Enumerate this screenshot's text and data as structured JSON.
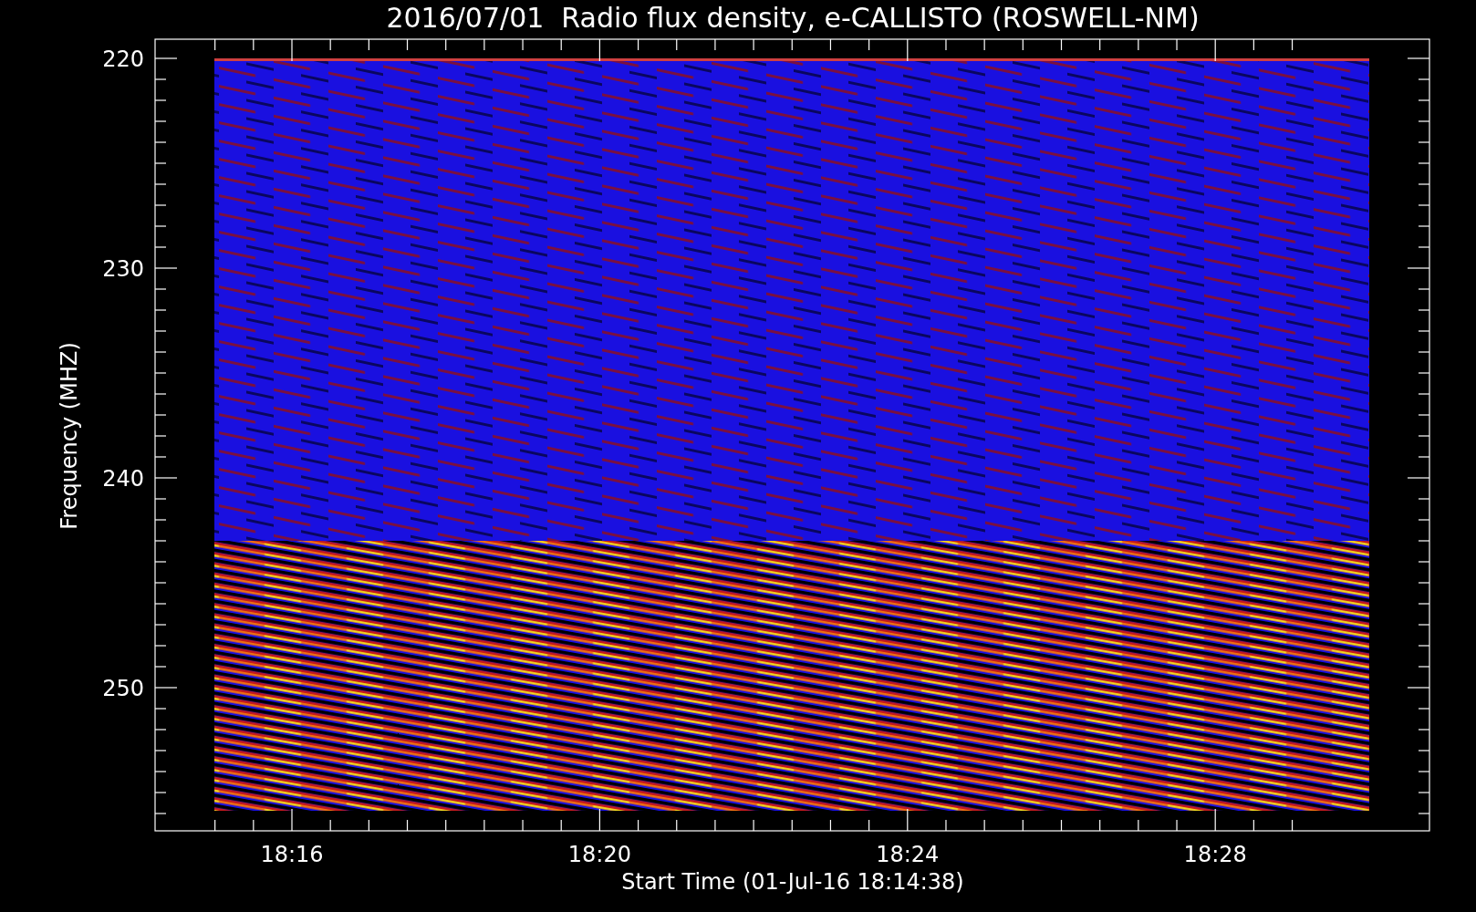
{
  "title": "2016/07/01  Radio flux density, e-CALLISTO (ROSWELL-NM)",
  "y_axis": {
    "label": "Frequency (MHZ)",
    "ticks": [
      "220",
      "230",
      "240",
      "250"
    ]
  },
  "x_axis": {
    "label": "Start Time (01-Jul-16 18:14:38)",
    "ticks": [
      "18:16",
      "18:20",
      "18:24",
      "18:28"
    ]
  }
}
